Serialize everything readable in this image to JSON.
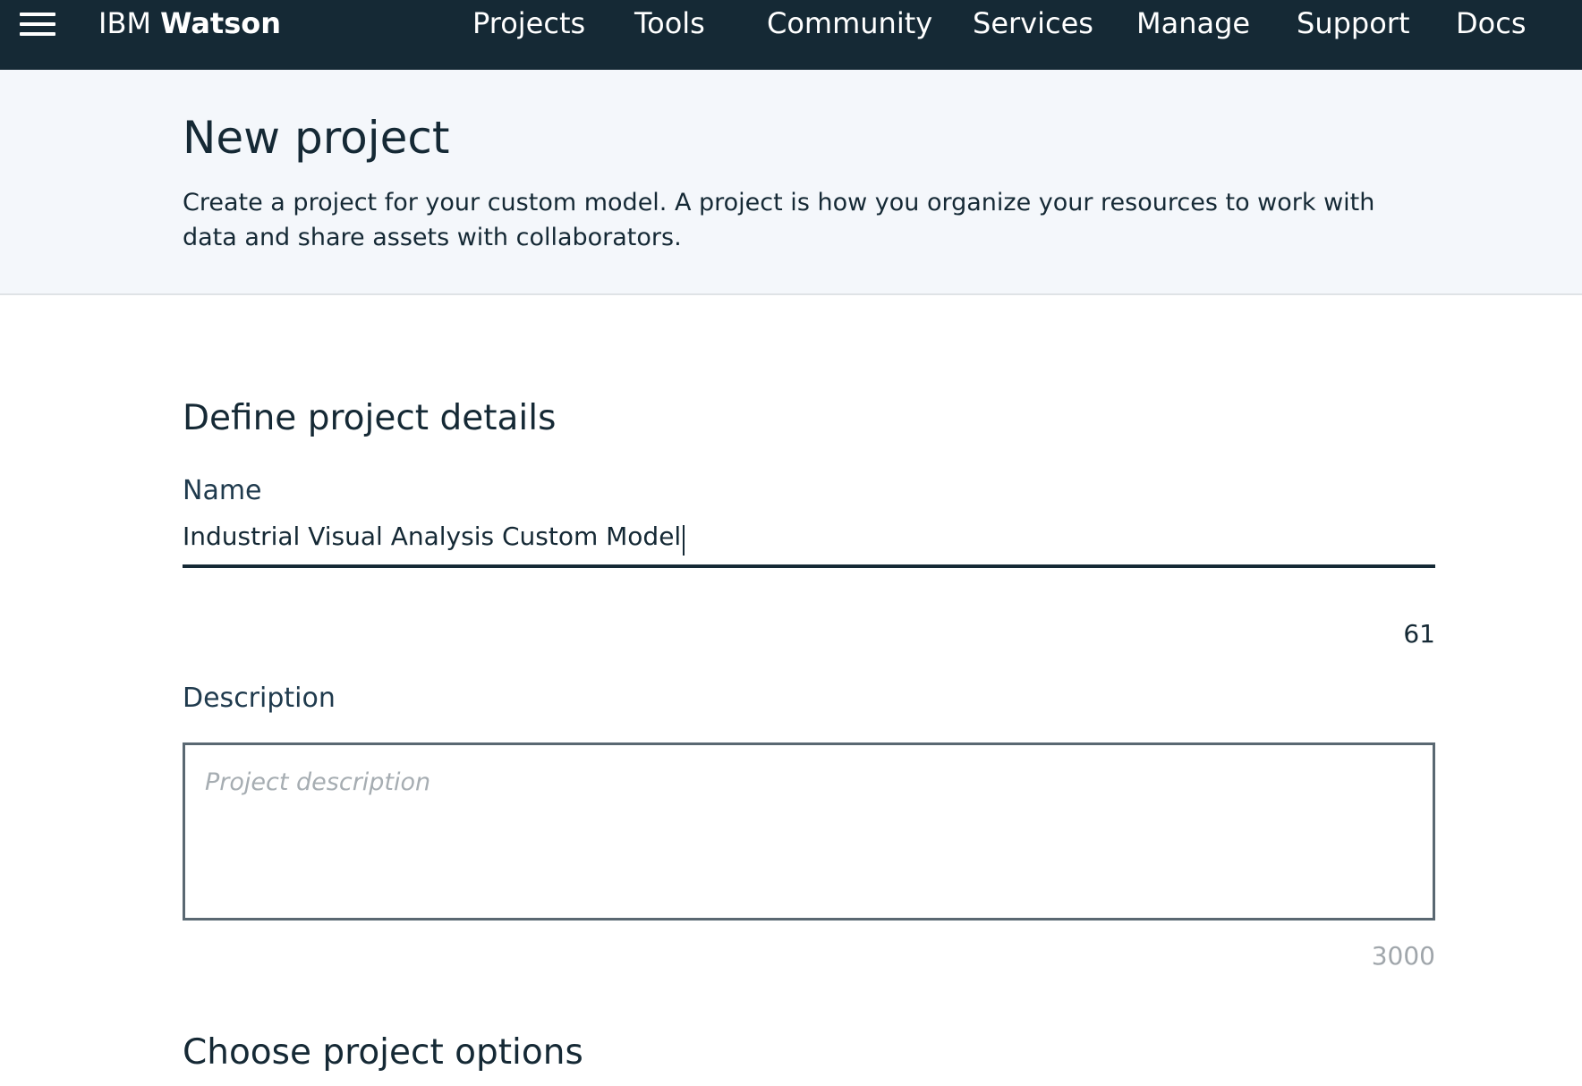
{
  "topbar": {
    "brand_light": "IBM",
    "brand_bold": "Watson",
    "nav": [
      {
        "label": "Projects"
      },
      {
        "label": "Tools"
      },
      {
        "label": "Community"
      },
      {
        "label": "Services"
      },
      {
        "label": "Manage"
      },
      {
        "label": "Support"
      },
      {
        "label": "Docs"
      }
    ]
  },
  "header": {
    "title": "New project",
    "description": "Create a project for your custom model. A project is how you organize your resources to work with data and share assets with collaborators."
  },
  "form": {
    "details_heading": "Define project details",
    "name": {
      "label": "Name",
      "value": "Industrial Visual Analysis Custom Model",
      "remaining": "61"
    },
    "description": {
      "label": "Description",
      "placeholder": "Project description",
      "value": "",
      "remaining": "3000"
    },
    "options_heading": "Choose project options"
  },
  "colors": {
    "topbar_bg": "#152935",
    "header_bg": "#f4f7fb",
    "text_primary": "#152935",
    "counter_muted": "#a0a6ab"
  }
}
